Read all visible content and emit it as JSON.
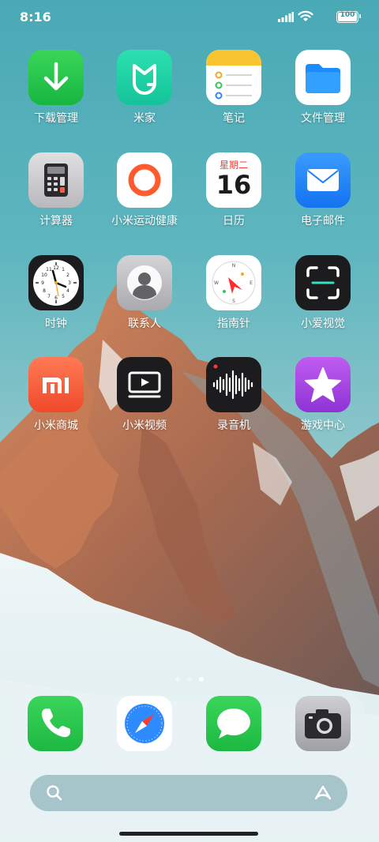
{
  "status_bar": {
    "time": "8:16",
    "battery": "100"
  },
  "apps": [
    {
      "label": "下载管理",
      "icon": "download-arrow-icon"
    },
    {
      "label": "米家",
      "icon": "mijia-icon"
    },
    {
      "label": "笔记",
      "icon": "notes-icon"
    },
    {
      "label": "文件管理",
      "icon": "folder-icon"
    },
    {
      "label": "计算器",
      "icon": "calculator-icon"
    },
    {
      "label": "小米运动健康",
      "icon": "health-ring-icon"
    },
    {
      "label": "日历",
      "icon": "calendar-icon",
      "weekday": "星期二",
      "day": "16"
    },
    {
      "label": "电子邮件",
      "icon": "mail-icon"
    },
    {
      "label": "时钟",
      "icon": "clock-icon"
    },
    {
      "label": "联系人",
      "icon": "contacts-icon"
    },
    {
      "label": "指南针",
      "icon": "compass-icon"
    },
    {
      "label": "小爱视觉",
      "icon": "scan-vision-icon"
    },
    {
      "label": "小米商城",
      "icon": "mi-store-icon",
      "logo_text": "mi"
    },
    {
      "label": "小米视频",
      "icon": "video-play-icon"
    },
    {
      "label": "录音机",
      "icon": "recorder-waveform-icon"
    },
    {
      "label": "游戏中心",
      "icon": "star-game-icon"
    }
  ],
  "dock": [
    {
      "name": "phone",
      "icon": "phone-icon"
    },
    {
      "name": "browser",
      "icon": "compass-browser-icon"
    },
    {
      "name": "messages",
      "icon": "message-bubble-icon"
    },
    {
      "name": "camera",
      "icon": "camera-icon"
    }
  ],
  "page_indicator": {
    "count": 3,
    "active": 3
  },
  "search_bar": {
    "left_icon": "search-icon",
    "right_icon": "assistant-icon"
  }
}
